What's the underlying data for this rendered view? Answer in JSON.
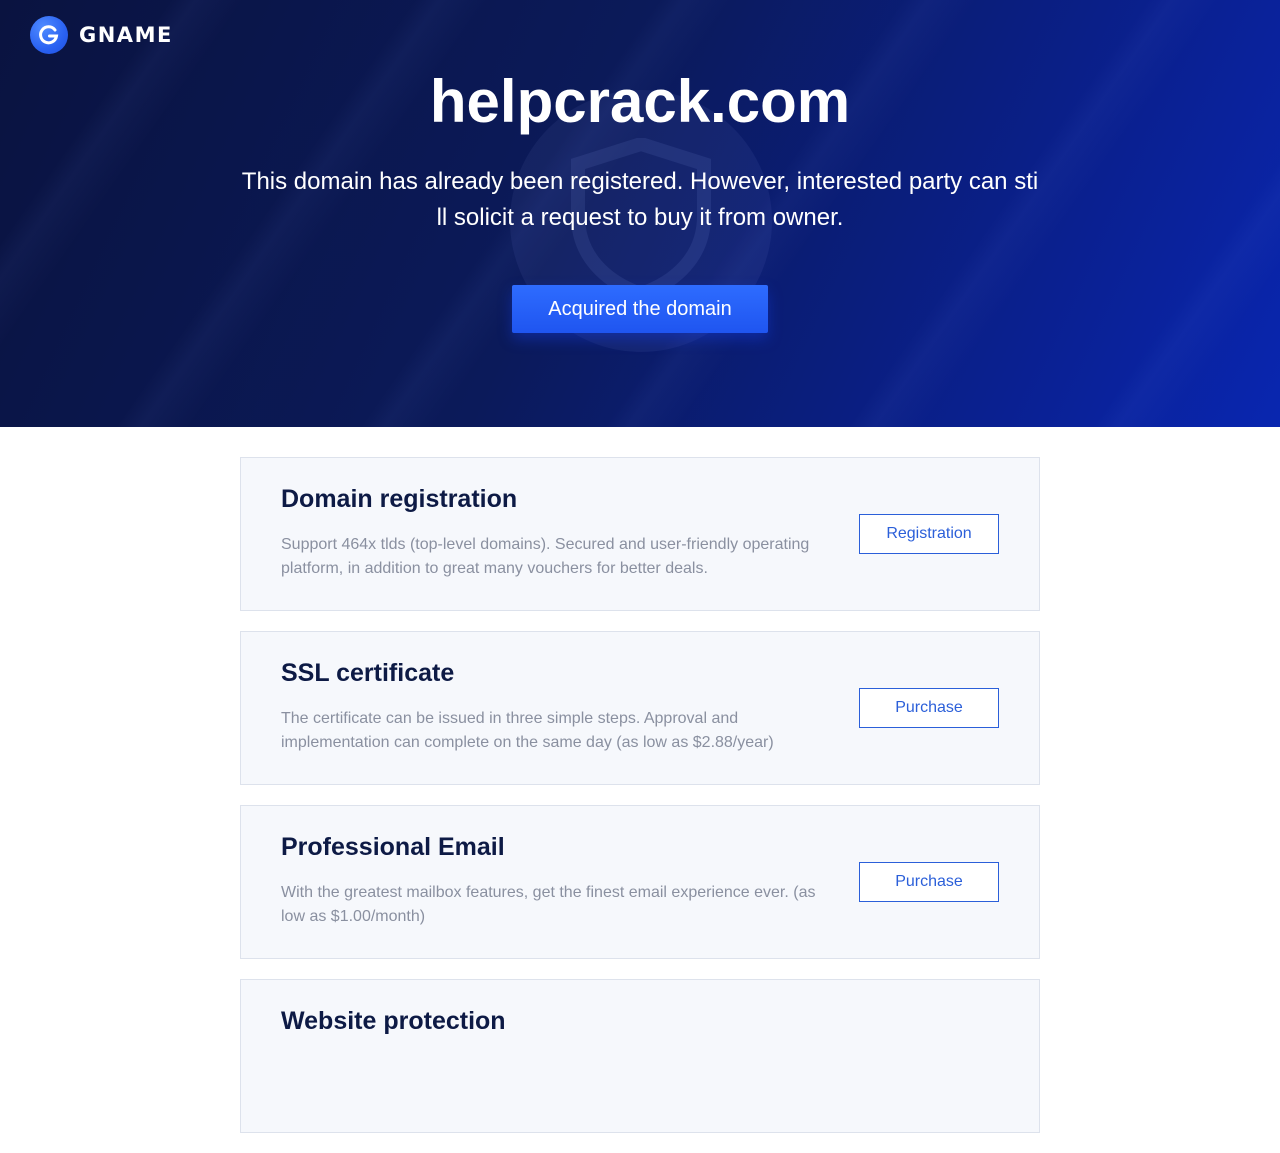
{
  "brand": {
    "name": "GNAME",
    "logo_icon": "gname-g-icon"
  },
  "hero": {
    "domain": "helpcrack.com",
    "message": "This domain has already been registered. However, interested party can still solicit a request to buy it from owner.",
    "cta_label": "Acquired the domain"
  },
  "services": [
    {
      "title": "Domain registration",
      "description": "Support 464x tlds (top-level domains). Secured and user-friendly operating platform, in addition to great many vouchers for better deals.",
      "button": "Registration"
    },
    {
      "title": "SSL certificate",
      "description": "The certificate can be issued in three simple steps. Approval and implementation can complete on the same day (as low as $2.88/year)",
      "button": "Purchase"
    },
    {
      "title": "Professional Email",
      "description": "With the greatest mailbox features, get the finest email experience ever. (as low as $1.00/month)",
      "button": "Purchase"
    },
    {
      "title": "Website protection",
      "description": "",
      "button": ""
    }
  ],
  "colors": {
    "hero_dark": "#0a1340",
    "hero_blue": "#0926b0",
    "accent": "#2b5fd9",
    "card_bg": "#f6f8fc"
  }
}
